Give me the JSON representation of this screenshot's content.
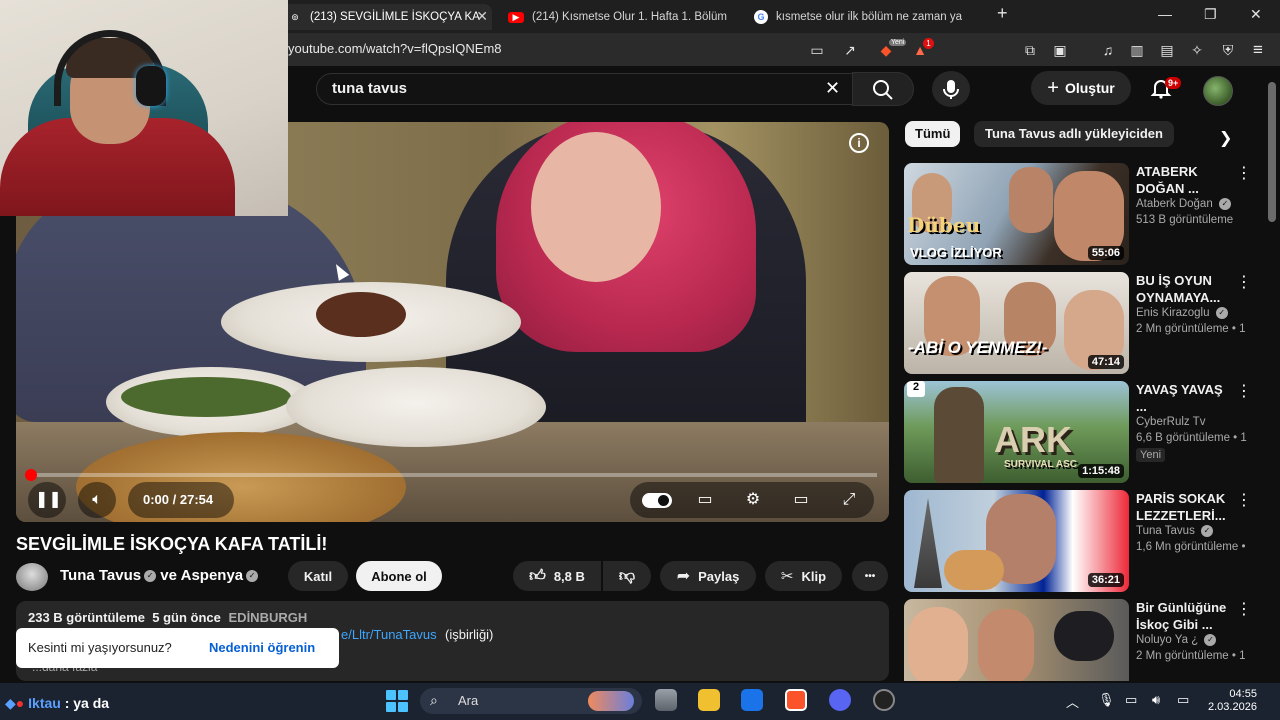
{
  "browser": {
    "tabs": [
      {
        "label": "(213) SEVGİLİMLE İSKOÇYA KA",
        "active": true,
        "icon": "youtube-icon"
      },
      {
        "label": "(214) Kısmetse Olur 1. Hafta 1. Bölüm",
        "active": false,
        "icon": "youtube-icon"
      },
      {
        "label": "kısmetse olur ilk bölüm ne zaman ya",
        "active": false,
        "icon": "google-icon"
      }
    ],
    "new_tab_label": "+",
    "url": "youtube.com/watch?v=flQpsIQNEm8",
    "brave_badge": "Yeni",
    "rewards_badge": "1"
  },
  "youtube": {
    "search_query": "tuna tavus",
    "create_label": "Oluştur",
    "notif_badge": "9+"
  },
  "player": {
    "time": "0:00 / 27:54",
    "progress": 0.004
  },
  "video": {
    "title": "SEVGİLİMLE İSKOÇYA KAFA TATİLİ!",
    "channel": "Tuna Tavus",
    "channel_connector": "ve",
    "channel2": "Aspenya",
    "join_label": "Katıl",
    "subscribe_label": "Abone ol",
    "likes": "8,8 B",
    "share_label": "Paylaş",
    "clip_label": "Klip",
    "more_label": "•••"
  },
  "description": {
    "views": "233 B görüntüleme",
    "age": "5 gün önce",
    "location": "EDİNBURGH",
    "link_text": "e/Lltr/TunaTavus",
    "collab_text": "(işbirliği)",
    "more_text": "...daha fazla"
  },
  "toast": {
    "message": "Kesinti mi yaşıyorsunuz?",
    "action": "Nedenini öğrenin"
  },
  "chips": {
    "all": "Tümü",
    "uploader": "Tuna Tavus adlı yükleyiciden"
  },
  "related": [
    {
      "title": "ATABERK DOĞAN ...",
      "channel": "Ataberk Doğan",
      "views": "513 B görüntüleme",
      "duration": "55:06",
      "overlay": "VLOG İZLİYOR",
      "overlay2": "Dübeu"
    },
    {
      "title": "BU İŞ OYUN OYNAMAYA...",
      "channel": "Enis Kirazoglu",
      "views": "2 Mn görüntüleme • 1",
      "duration": "47:14",
      "overlay": "-ABİ O YENMEZ!-"
    },
    {
      "title": "YAVAŞ YAVAŞ ...",
      "channel": "CyberRulz Tv",
      "views": "6,6 B görüntüleme • 1",
      "duration": "1:15:48",
      "badge": "Yeni",
      "overlay": "ARK",
      "overlay2": "SURVIVAL ASC",
      "number": "2"
    },
    {
      "title": "PARİS SOKAK LEZZETLERİ...",
      "channel": "Tuna Tavus",
      "views": "1,6 Mn görüntüleme •",
      "duration": "36:21"
    },
    {
      "title": "Bir Günlüğüne İskoç Gibi ...",
      "channel": "Noluyo Ya ¿",
      "views": "2 Mn görüntüleme • 1"
    }
  ],
  "taskbar": {
    "chat_user": "Iktau",
    "chat_text": ": ya da",
    "search_label": "Ara",
    "time": "04:55",
    "date": "2.03.2026"
  },
  "colors": {
    "accent": "#ff0000",
    "link": "#3ea6ff",
    "background": "#0f0f0f"
  }
}
